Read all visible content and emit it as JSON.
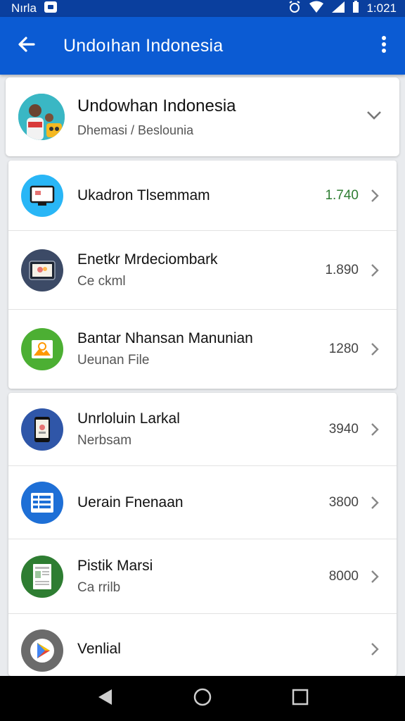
{
  "status_bar": {
    "carrier": "Nırla",
    "time": "1:021",
    "icons": [
      "notification-icon",
      "alarm-icon",
      "wifi-icon",
      "signal-icon",
      "battery-icon"
    ]
  },
  "app_bar": {
    "title": "Undoıhan Indonesia",
    "back_icon": "arrow-back-icon",
    "menu_icon": "more-vert-icon"
  },
  "header": {
    "title": "Undowhan Indonesia",
    "subtitle": "Dhemasi / Beslounia",
    "expand_icon": "chevron-down-icon"
  },
  "groups": [
    {
      "items": [
        {
          "title": "Ukadron Tlsemmam",
          "subtitle": "",
          "value": "1.740",
          "value_color": "#2e7d32",
          "icon": "monitor-icon",
          "icon_bg": "#29b6f6"
        },
        {
          "title": "Enetkr Mrdeciombark",
          "subtitle": "Ce ckml",
          "value": "1.890",
          "value_color": "#444444",
          "icon": "tablet-icon",
          "icon_bg": "#3c4a66"
        },
        {
          "title": "Bantar Nhansan Manunian",
          "subtitle": "Ueunan File",
          "value": "1280",
          "value_color": "#444444",
          "icon": "image-icon",
          "icon_bg": "#4caf33"
        }
      ]
    },
    {
      "items": [
        {
          "title": "Unrloluin Larkal",
          "subtitle": "Nerbsam",
          "value": "3940",
          "value_color": "#444444",
          "icon": "phone-icon",
          "icon_bg": "#2f56a8"
        },
        {
          "title": "Uerain Fnenaan",
          "subtitle": "",
          "value": "3800",
          "value_color": "#444444",
          "icon": "spreadsheet-icon",
          "icon_bg": "#1e6fd6"
        },
        {
          "title": "Pistik Marsi",
          "subtitle": "Ca rrilb",
          "value": "8000",
          "value_color": "#444444",
          "icon": "document-icon",
          "icon_bg": "#2e7d32"
        },
        {
          "title": "Venlial",
          "subtitle": "",
          "value": "",
          "value_color": "#444444",
          "icon": "play-store-icon",
          "icon_bg": "#6b6b6b"
        }
      ]
    }
  ],
  "nav_bar": {
    "icons": [
      "nav-back-icon",
      "nav-home-icon",
      "nav-recents-icon"
    ]
  }
}
